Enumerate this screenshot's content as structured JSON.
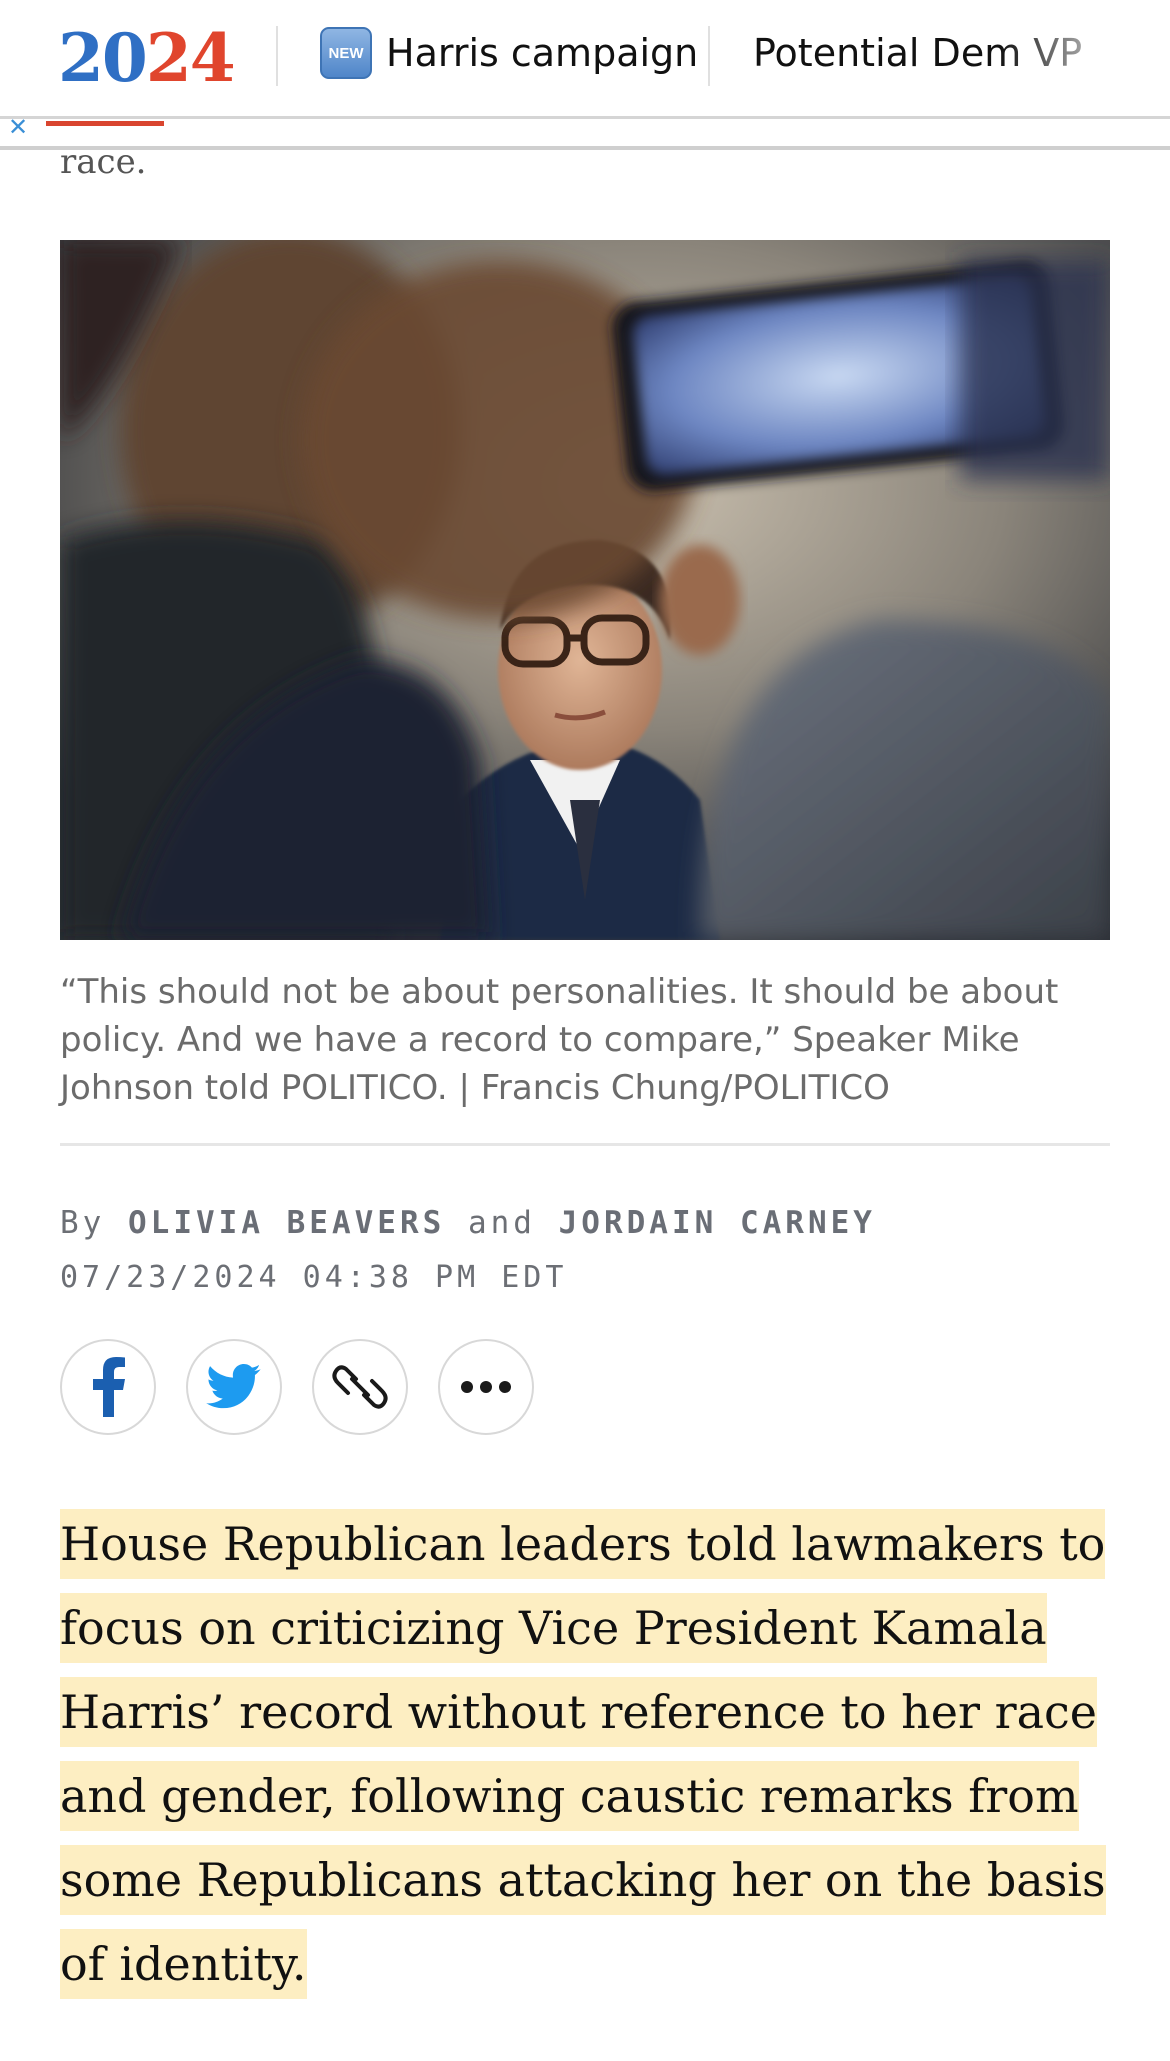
{
  "nav": {
    "logo": {
      "digits_blue": "20",
      "digits_red": "2",
      "digits_blue2": "4"
    },
    "badge": "NEW",
    "items": [
      "Harris campaign",
      "Potential Dem VP"
    ]
  },
  "article": {
    "previous_text_fragment": "race.",
    "photo_caption": "“This should not be about personalities. It should be about policy. And we have a record to compare,” Speaker Mike Johnson told POLITICO. | Francis Chung/POLITICO",
    "byline": {
      "prefix": "By",
      "author1": "OLIVIA BEAVERS",
      "joiner": "and",
      "author2": "JORDAIN CARNEY"
    },
    "date": "07/23/2024 04:38 PM EDT",
    "share_buttons": [
      "facebook-icon",
      "twitter-icon",
      "link-icon",
      "more-icon"
    ],
    "lede": "House Republican leaders told lawmakers to focus on criticizing Vice President Kamala Harris’ record without reference to her race and gender, following caustic remarks from some Republicans attacking her on the basis of identity."
  },
  "colors": {
    "logo_blue": "#2f6fc4",
    "logo_red": "#e0452d",
    "highlight": "#fdeec2",
    "facebook": "#1b5fb0",
    "twitter": "#1d9bf0"
  }
}
